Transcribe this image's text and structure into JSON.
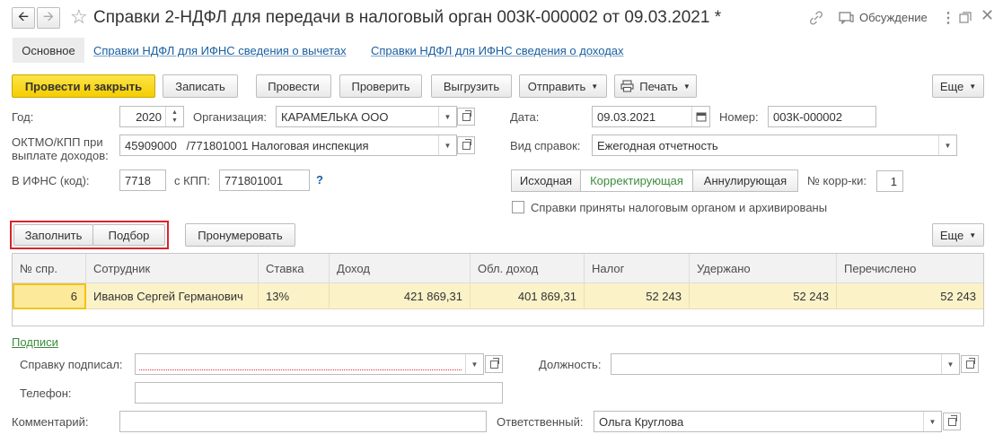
{
  "window": {
    "title": "Справки 2-НДФЛ для передачи в налоговый орган 003К-000002 от 09.03.2021 *",
    "discussion_label": "Обсуждение"
  },
  "tabs": [
    {
      "label": "Основное"
    },
    {
      "label": "Справки НДФЛ для ИФНС сведения о вычетах"
    },
    {
      "label": "Справки НДФЛ для ИФНС сведения о доходах"
    }
  ],
  "toolbar": {
    "post_close": "Провести и закрыть",
    "save": "Записать",
    "post": "Провести",
    "check": "Проверить",
    "export": "Выгрузить",
    "send": "Отправить",
    "print": "Печать",
    "more": "Еще"
  },
  "form": {
    "year_label": "Год:",
    "year_value": "2020",
    "org_label": "Организация:",
    "org_value": "КАРАМЕЛЬКА ООО",
    "date_label": "Дата:",
    "date_value": "09.03.2021",
    "number_label": "Номер:",
    "number_value": "003К-000002",
    "oktmo_label_1": "ОКТМО/КПП при",
    "oktmo_label_2": "выплате доходов:",
    "oktmo_value": "45909000   /771801001 Налоговая инспекция",
    "kind_label": "Вид справок:",
    "kind_value": "Ежегодная отчетность",
    "ifns_label": "В ИФНС (код):",
    "ifns_value": "7718",
    "kpp_label": "с КПП:",
    "kpp_value": "771801001",
    "help": "?",
    "seg_original": "Исходная",
    "seg_corrective": "Корректирующая",
    "seg_cancel": "Аннулирующая",
    "corr_label": "№ корр-ки:",
    "corr_value": "1",
    "archived_label": "Справки приняты налоговым органом и архивированы"
  },
  "table_toolbar": {
    "fill": "Заполнить",
    "select": "Подбор",
    "number": "Пронумеровать",
    "more": "Еще"
  },
  "table": {
    "headers": [
      "№ спр.",
      "Сотрудник",
      "Ставка",
      "Доход",
      "Обл. доход",
      "Налог",
      "Удержано",
      "Перечислено"
    ],
    "rows": [
      [
        "6",
        "Иванов Сергей Германович",
        "13%",
        "421 869,31",
        "401 869,31",
        "52 243",
        "52 243",
        "52 243"
      ]
    ]
  },
  "signatures": {
    "link": "Подписи",
    "signed_label": "Справку подписал:",
    "signed_value": "",
    "position_label": "Должность:",
    "position_value": "",
    "phone_label": "Телефон:",
    "phone_value": "",
    "comment_label": "Комментарий:",
    "comment_value": "",
    "responsible_label": "Ответственный:",
    "responsible_value": "Ольга Круглова"
  },
  "colors": {
    "primary_button": "#f5cd00",
    "highlight_box": "#d9232d",
    "row_highlight": "#fcf2c8",
    "link": "#1a5fa0"
  }
}
